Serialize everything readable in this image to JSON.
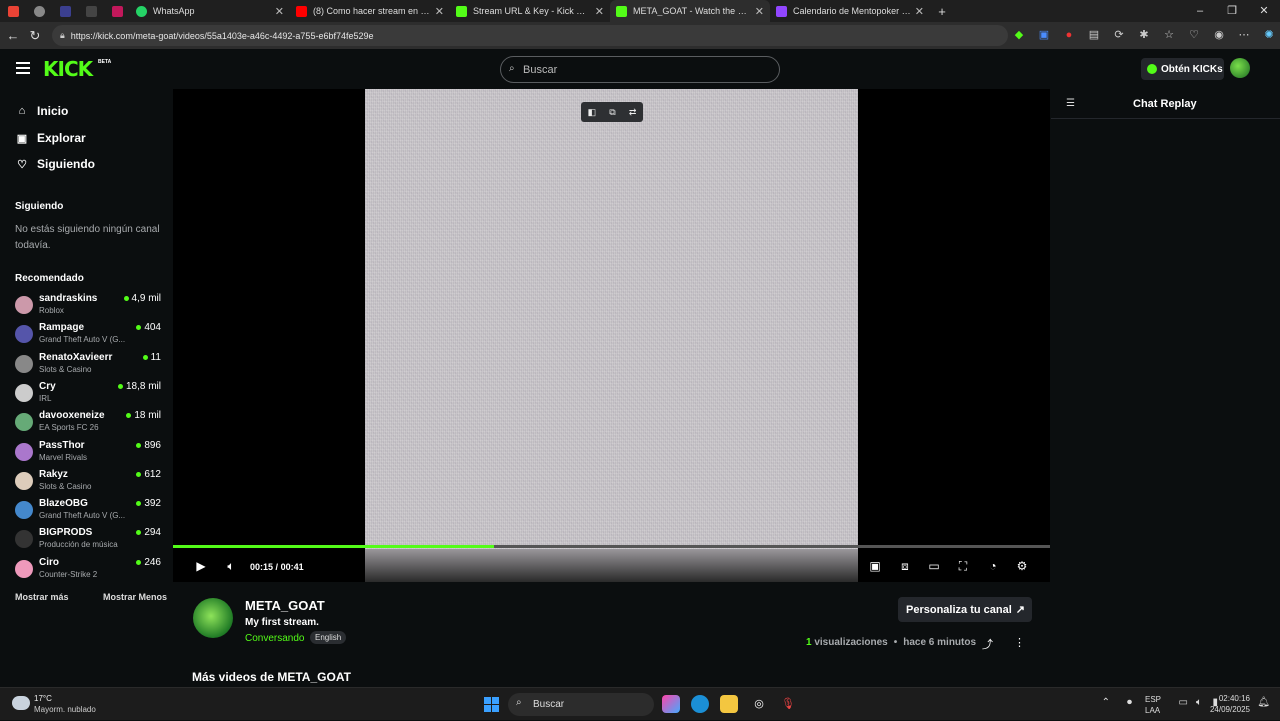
{
  "browser": {
    "tabs": [
      {
        "label": "WhatsApp"
      },
      {
        "label": "(8) Como hacer stream en kick 20"
      },
      {
        "label": "Stream URL & Key - Kick Dashboa"
      },
      {
        "label": "META_GOAT - Watch the VOD on"
      },
      {
        "label": "Calendario de Mentopoker - Twit"
      }
    ],
    "url": "https://kick.com/meta-goat/videos/55a1403e-a46c-4492-a755-e6bf74fe529e"
  },
  "header": {
    "logo": "KICK",
    "logo_badge": "BETA",
    "search_placeholder": "Buscar",
    "kicks_button": "Obtén KICKs"
  },
  "sidebar": {
    "nav": [
      {
        "label": "Inicio",
        "icon": "home-icon"
      },
      {
        "label": "Explorar",
        "icon": "browse-icon"
      },
      {
        "label": "Siguiendo",
        "icon": "heart-icon"
      }
    ],
    "following_title": "Siguiendo",
    "following_empty": "No estás siguiendo ningún canal todavía.",
    "recommended_title": "Recomendado",
    "recommended": [
      {
        "name": "sandraskins",
        "category": "Roblox",
        "viewers": "4,9 mil"
      },
      {
        "name": "Rampage",
        "category": "Grand Theft Auto V (G...",
        "viewers": "404"
      },
      {
        "name": "RenatoXavieerr",
        "category": "Slots & Casino",
        "viewers": "11"
      },
      {
        "name": "Cry",
        "category": "IRL",
        "viewers": "18,8 mil"
      },
      {
        "name": "davooxeneize",
        "category": "EA Sports FC 26",
        "viewers": "18 mil"
      },
      {
        "name": "PassThor",
        "category": "Marvel Rivals",
        "viewers": "896"
      },
      {
        "name": "Rakyz",
        "category": "Slots & Casino",
        "viewers": "612"
      },
      {
        "name": "BlazeOBG",
        "category": "Grand Theft Auto V (G...",
        "viewers": "392"
      },
      {
        "name": "BIGPRODS",
        "category": "Producción de música",
        "viewers": "294"
      },
      {
        "name": "Ciro",
        "category": "Counter-Strike 2",
        "viewers": "246"
      }
    ],
    "show_more": "Mostrar más",
    "show_less": "Mostrar Menos"
  },
  "player": {
    "current_time": "00:15",
    "duration": "00:41",
    "time_separator": "/",
    "progress_fraction": 0.366
  },
  "chat": {
    "title": "Chat Replay"
  },
  "video_info": {
    "channel": "META_GOAT",
    "title": "My first stream.",
    "category": "Conversando",
    "language": "English",
    "customize_button": "Personaliza tu canal",
    "views_count": "1",
    "views_label": "visualizaciones",
    "bullet": "•",
    "age": "hace 6 minutos",
    "more_videos": "Más videos de META_GOAT"
  },
  "taskbar": {
    "temperature": "17°C",
    "weather": "Mayorm. nublado",
    "search": "Buscar",
    "lang_line1": "ESP",
    "lang_line2": "LAA",
    "time": "02:40:16",
    "date": "24/09/2025"
  },
  "colors": {
    "accent": "#53fc18",
    "background": "#0b0e0f"
  }
}
